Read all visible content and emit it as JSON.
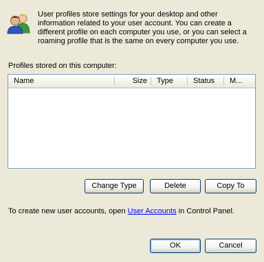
{
  "intro": {
    "lines": [
      "User profiles store settings for your desktop and other",
      "information related to your user account. You can create a",
      "different profile on each computer you use, or you can select a",
      "roaming profile that is the same on every computer you use."
    ]
  },
  "profiles": {
    "label": "Profiles stored on this computer:",
    "columns": [
      "Name",
      "Size",
      "Type",
      "Status",
      "M..."
    ]
  },
  "buttons": {
    "change_type": "Change Type",
    "delete": "Delete",
    "copy_to": "Copy To",
    "ok": "OK",
    "cancel": "Cancel"
  },
  "footer": {
    "prefix": "To create new user accounts, open ",
    "link": "User Accounts",
    "suffix": " in Control Panel."
  },
  "icons": {
    "users": "users-icon"
  }
}
